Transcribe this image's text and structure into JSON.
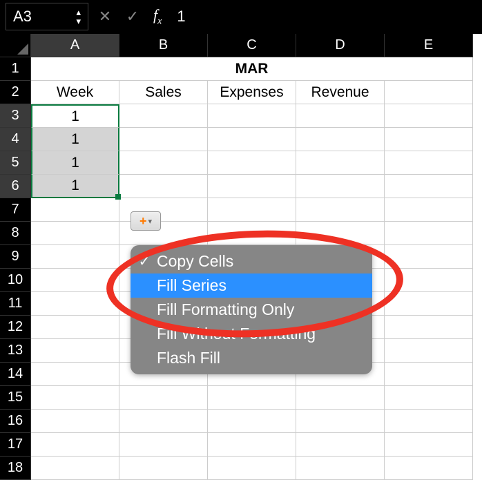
{
  "formula_bar": {
    "name_box": "A3",
    "cancel_glyph": "✕",
    "confirm_glyph": "✓",
    "fx_label": "f",
    "fx_sub": "x",
    "value": "1"
  },
  "columns": [
    "A",
    "B",
    "C",
    "D",
    "E"
  ],
  "rows": [
    "1",
    "2",
    "3",
    "4",
    "5",
    "6",
    "7",
    "8",
    "9",
    "10",
    "11",
    "12",
    "13",
    "14",
    "15",
    "16",
    "17",
    "18"
  ],
  "title_merged": "MAR",
  "headers": {
    "A": "Week",
    "B": "Sales",
    "C": "Expenses",
    "D": "Revenue"
  },
  "col_a_values": [
    "1",
    "1",
    "1",
    "1"
  ],
  "autofill": {
    "plus": "+",
    "arrow": "▾"
  },
  "menu": {
    "items": [
      {
        "label": "Copy Cells",
        "checked": true,
        "highlight": false
      },
      {
        "label": "Fill Series",
        "checked": false,
        "highlight": true
      },
      {
        "label": "Fill Formatting Only",
        "checked": false,
        "highlight": false
      },
      {
        "label": "Fill Without Formatting",
        "checked": false,
        "highlight": false
      },
      {
        "label": "Flash Fill",
        "checked": false,
        "highlight": false
      }
    ]
  }
}
